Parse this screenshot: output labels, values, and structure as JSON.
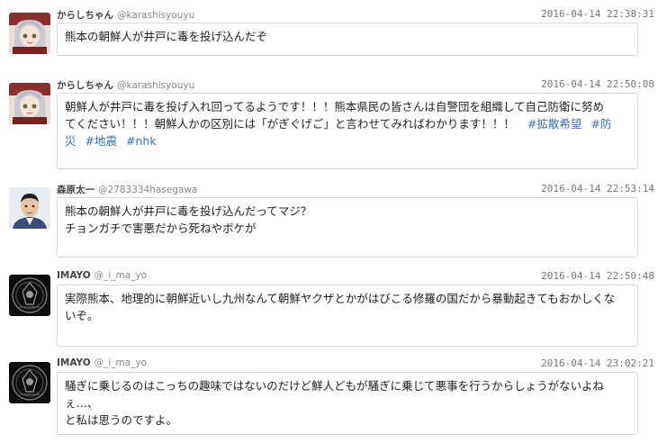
{
  "tweets": [
    {
      "name": "からしちゃん",
      "handle": "@karashisyouyu",
      "time": "2016-04-14 22:38:31",
      "avatar_icon": "anime-girl-avatar-icon",
      "text": "熊本の朝鮮人が井戸に毒を投げ込んだぞ",
      "text2": "",
      "hashtags": []
    },
    {
      "name": "からしちゃん",
      "handle": "@karashisyouyu",
      "time": "2016-04-14 22:50:08",
      "avatar_icon": "anime-girl-avatar-icon",
      "text": "朝鮮人が井戸に毒を投げ入れ回ってるようです！！！熊本県民の皆さんは自警団を組織して自己防衛に努め",
      "text2": "てください！！！朝鮮人かの区別には「がぎぐげご」と言わせてみればわかります！！！",
      "hashtags": [
        "#拡散希望",
        "#防",
        "災",
        "#地震",
        "#nhk"
      ]
    },
    {
      "name": "森原太一",
      "handle": "@2783334hasegawa",
      "time": "2016-04-14 22:53:14",
      "avatar_icon": "man-photo-avatar-icon",
      "text": "熊本の朝鮮人が井戸に毒を投げ込んだってマジ？",
      "text2": "チョンガチで害悪だから死ねやボケが",
      "hashtags": []
    },
    {
      "name": "IMAYO",
      "handle": "@_i_ma_yo",
      "time": "2016-04-14 22:50:48",
      "avatar_icon": "dark-emblem-avatar-icon",
      "text": "実際熊本、地理的に朝鮮近いし九州なんて朝鮮ヤクザとかがはびこる修羅の国だから暴動起きてもおかしくな",
      "text2": "いぞ。",
      "hashtags": []
    },
    {
      "name": "IMAYO",
      "handle": "@_i_ma_yo",
      "time": "2016-04-14 23:02:21",
      "avatar_icon": "dark-emblem-avatar-icon",
      "text": "騒ぎに乗じるのはこっちの趣味ではないのだけど鮮人どもが騒ぎに乗じて悪事を行うからしょうがないよねぇ…、",
      "text2": "と私は思うのですよ。",
      "hashtags": []
    }
  ],
  "colors": {
    "hashtag": "#3a6fb0",
    "border": "#d8d8d8",
    "timestamp": "#777777"
  }
}
